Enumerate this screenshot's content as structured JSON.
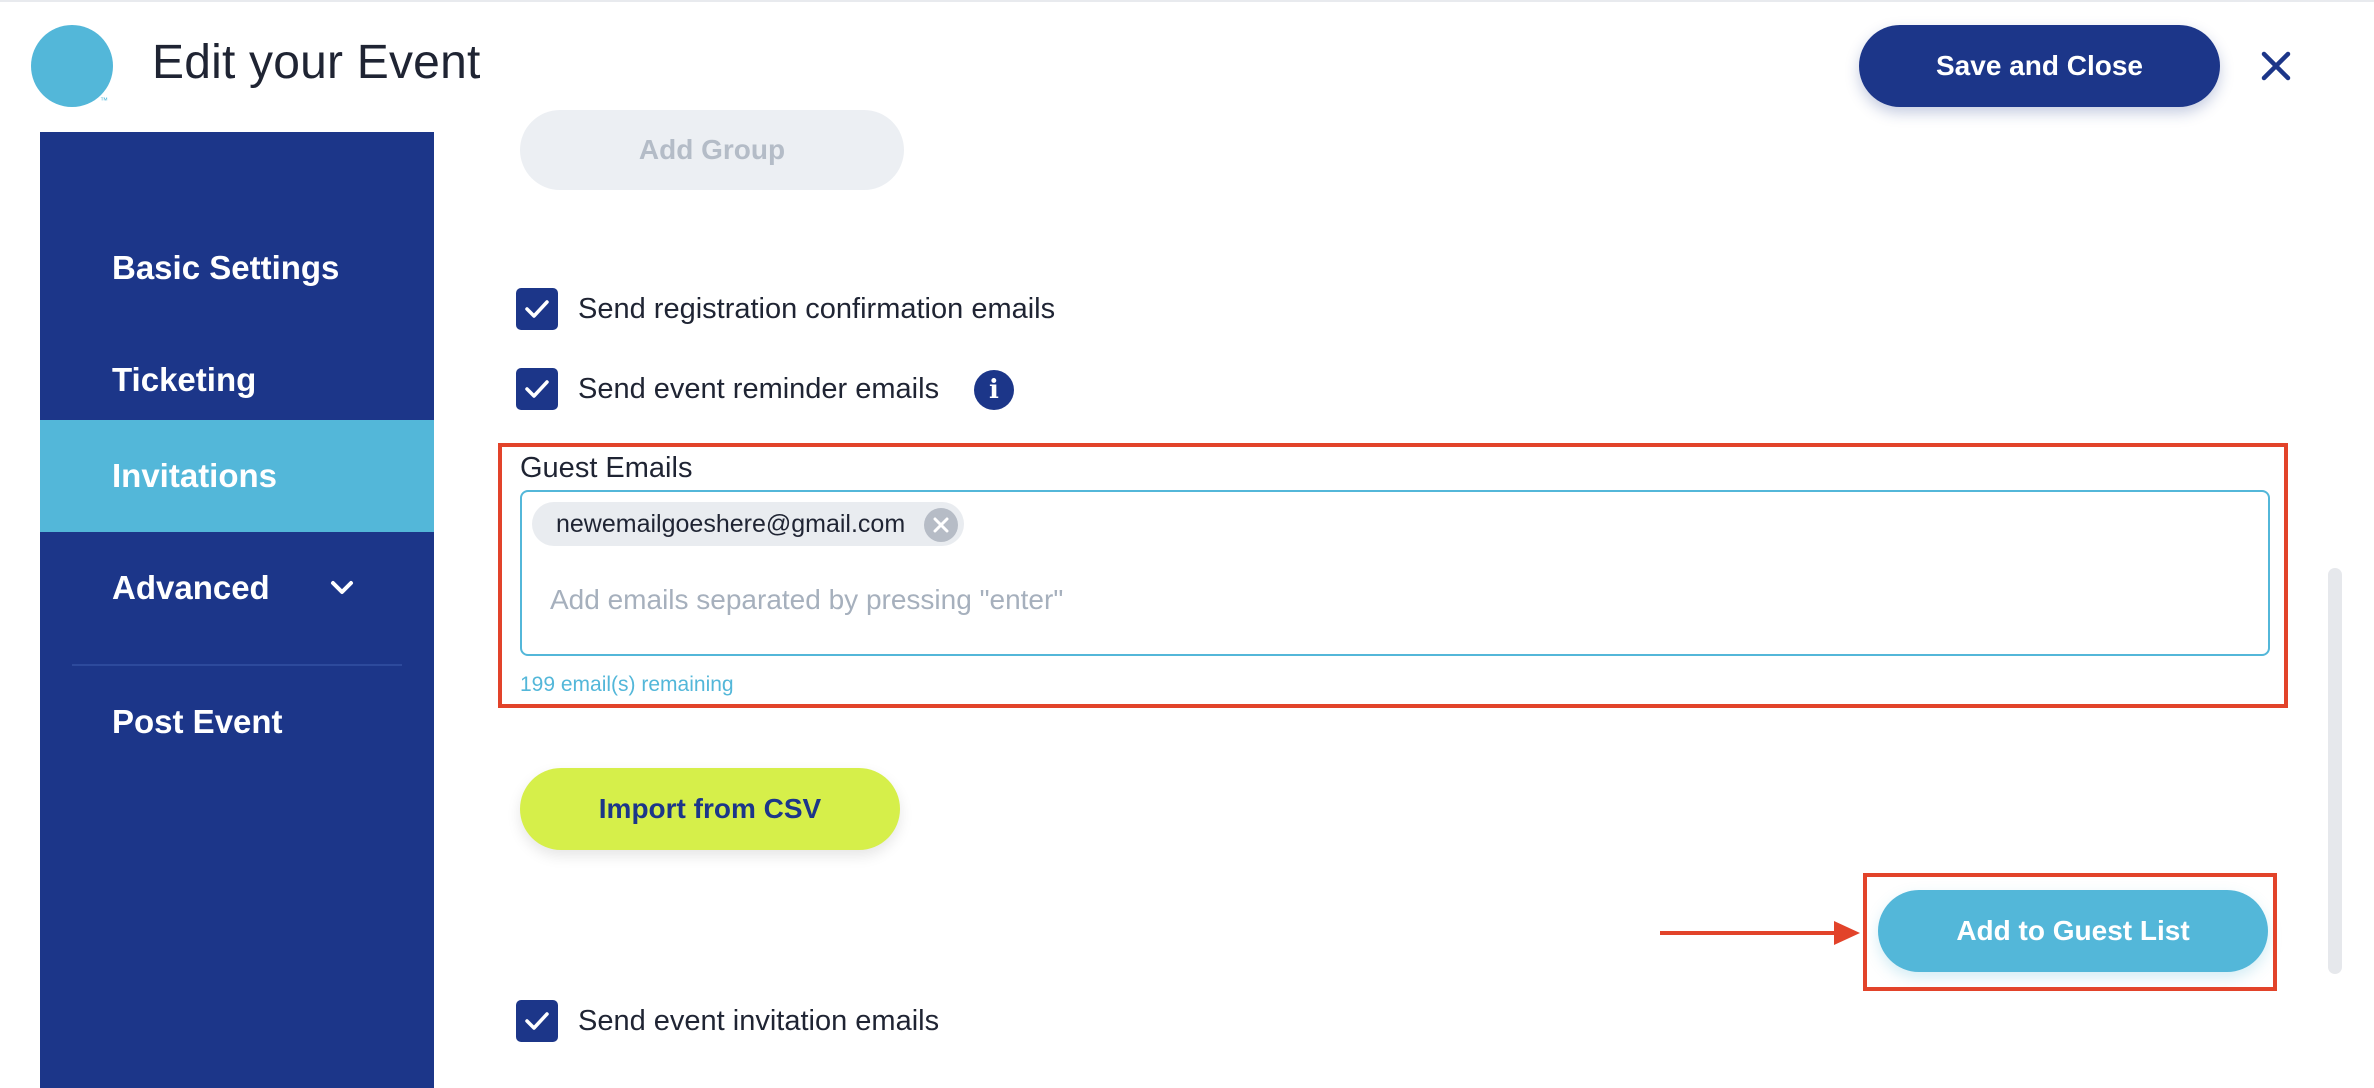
{
  "header": {
    "title": "Edit your Event",
    "trademark": "™",
    "save_label": "Save and Close",
    "close_icon": "close-icon"
  },
  "sidebar": {
    "items": [
      {
        "label": "Basic Settings",
        "active": false
      },
      {
        "label": "Ticketing",
        "active": false
      },
      {
        "label": "Invitations",
        "active": true
      },
      {
        "label": "Advanced",
        "active": false,
        "icon": "chevron-down-icon"
      },
      {
        "label": "Post Event",
        "active": false
      }
    ]
  },
  "main": {
    "add_group_label": "Add Group",
    "checkboxes": {
      "registration": {
        "label": "Send registration confirmation emails",
        "checked": true
      },
      "reminder": {
        "label": "Send event reminder emails",
        "checked": true,
        "info_icon": "i"
      },
      "invitation": {
        "label": "Send event invitation emails",
        "checked": true
      }
    },
    "guest_emails": {
      "label": "Guest Emails",
      "chips": [
        "newemailgoeshere@gmail.com"
      ],
      "placeholder": "Add emails separated by pressing \"enter\"",
      "remaining": "199 email(s) remaining"
    },
    "import_label": "Import from CSV",
    "add_to_guest_label": "Add to Guest List"
  },
  "colors": {
    "navy": "#1c3689",
    "accent_blue": "#53b7d9",
    "lime": "#d6ef4a",
    "annotation_red": "#e2432a"
  }
}
